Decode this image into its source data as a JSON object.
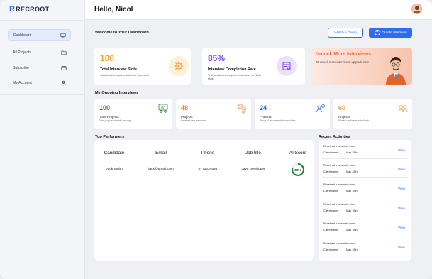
{
  "app": {
    "logo": "RECROOT",
    "logo_mark": "R"
  },
  "sidebar": {
    "items": [
      {
        "label": "Dashboard",
        "icon": "monitor-icon",
        "active": true
      },
      {
        "label": "All Projects",
        "icon": "folder-icon",
        "active": false
      },
      {
        "label": "Subscribe",
        "icon": "card-icon",
        "active": false
      },
      {
        "label": "My Account",
        "icon": "user-icon",
        "active": false
      }
    ]
  },
  "header": {
    "greeting": "Hello, Nicol"
  },
  "dashboard": {
    "welcome": "Welcome to Your Dashboard",
    "watch_demo": "Watch a Demo",
    "create_interview": "Create Interview",
    "stats": [
      {
        "value": "100",
        "title": "Total Interview Slots",
        "sub": "Total interview slots available for this month",
        "color": "#f3a31b"
      },
      {
        "value": "85%",
        "title": "Interview Completion Rate",
        "sub": "% of candidates completed interviews on (Total slots)",
        "color": "#7b3fe4"
      }
    ],
    "promo": {
      "title": "Unlock More Interviews",
      "sub": "To unlock more interviews, upgrade now"
    }
  },
  "ongoing": {
    "title": "My Ongoing Interviews",
    "cards": [
      {
        "value": "100",
        "label": "Total Projects",
        "sub": "Total projects currently ongoing",
        "color": "#1e8a3e"
      },
      {
        "value": "48",
        "label": "Projects",
        "sub": "Received new responses",
        "color": "#f07c30"
      },
      {
        "value": "24",
        "label": "Projects",
        "sub": "Ready AI recommended candidates",
        "color": "#2b6ff0"
      },
      {
        "value": "60",
        "label": "Projects",
        "sub": "Shared candidates with clients",
        "color": "#e8a24a"
      }
    ]
  },
  "performers": {
    "title": "Top Performers",
    "columns": [
      "Candidate",
      "Email",
      "Phone",
      "Job title",
      "AI Score"
    ],
    "rows": [
      {
        "candidate": "Jack Smith",
        "email": "jack@gmail.com",
        "phone": "0771234536",
        "job": "Java Developer",
        "score": "80%",
        "score_value": 0.8
      }
    ]
  },
  "activities": {
    "title": "Recent Activities",
    "items": [
      {
        "text": "Received a new note from",
        "client": "Client name",
        "date": "May 18th",
        "action": "View"
      },
      {
        "text": "Received a new note from",
        "client": "Client name",
        "date": "May 18th",
        "action": "View"
      },
      {
        "text": "Received a new note from",
        "client": "Client name",
        "date": "May 18th",
        "action": "View"
      },
      {
        "text": "Received a new note from",
        "client": "Client name",
        "date": "May 18th",
        "action": "View"
      },
      {
        "text": "Received a new note from",
        "client": "Client name",
        "date": "May 18th",
        "action": "View"
      },
      {
        "text": "Received a new note from",
        "client": "Client name",
        "date": "May 18th",
        "action": "View"
      }
    ]
  }
}
